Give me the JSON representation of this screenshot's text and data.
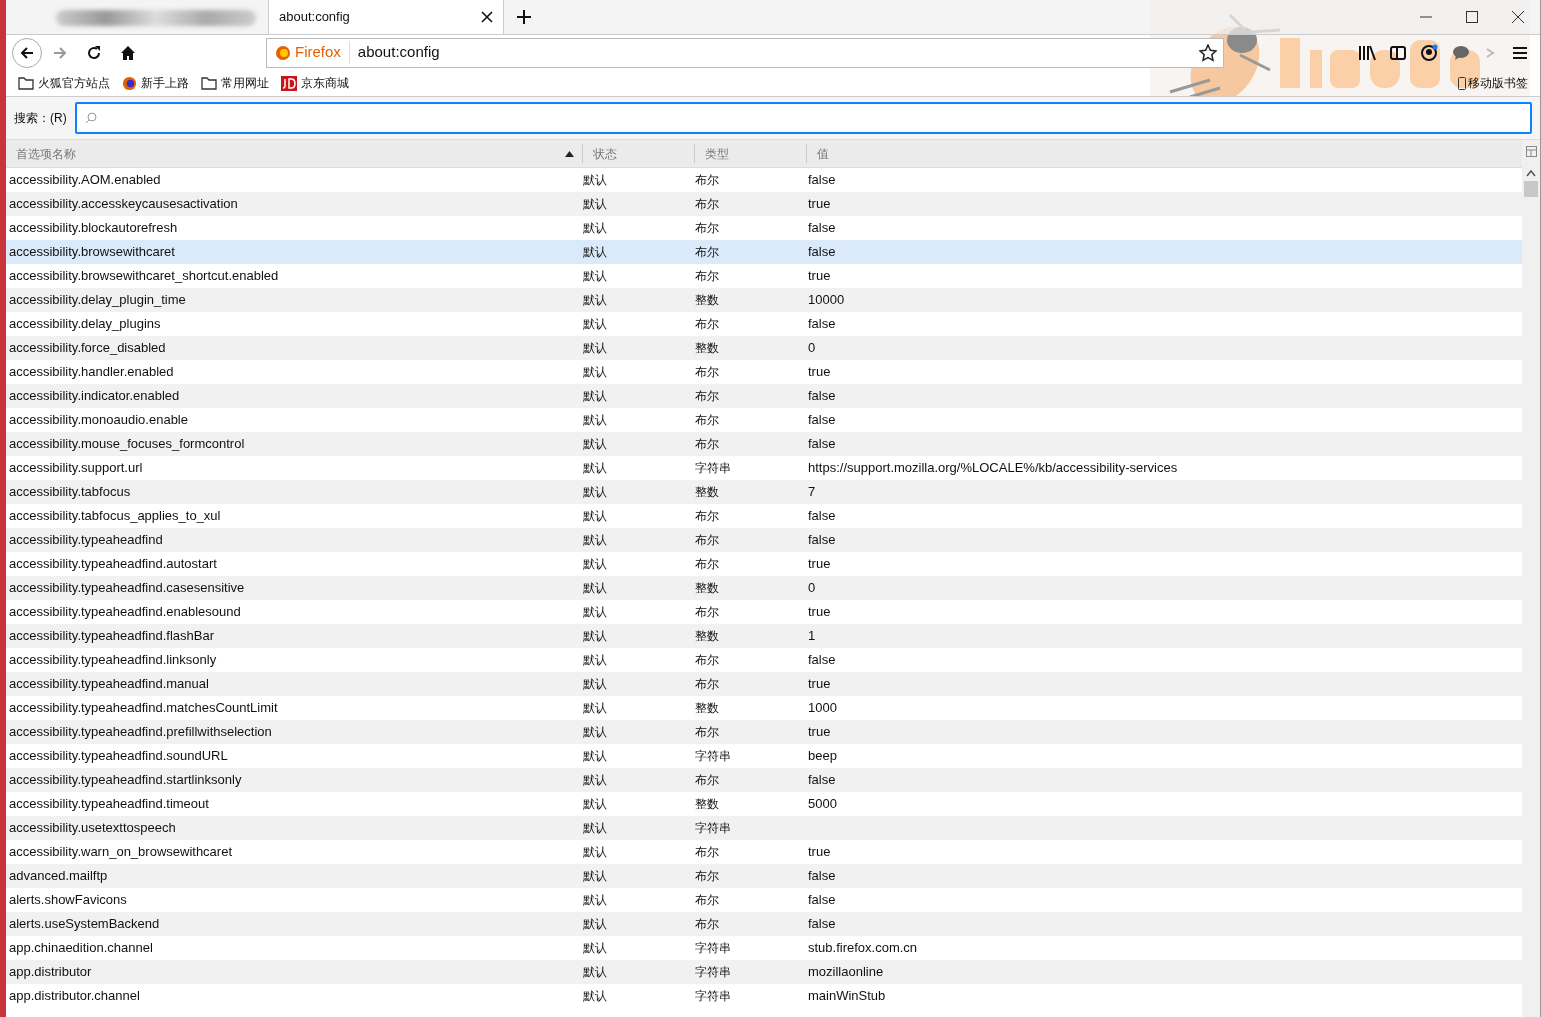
{
  "tabs": [
    {
      "kind": "blurred",
      "selected": false
    },
    {
      "kind": "page",
      "title": "about:config",
      "selected": true
    }
  ],
  "urlbar": {
    "identity": "Firefox",
    "url": "about:config"
  },
  "bookmarks": [
    {
      "kind": "folder",
      "label": "火狐官方站点"
    },
    {
      "kind": "firefox",
      "label": "新手上路"
    },
    {
      "kind": "folder",
      "label": "常用网址"
    },
    {
      "kind": "jd",
      "label": "京东商城"
    }
  ],
  "mobile_bookmarks": "移动版书签",
  "search": {
    "label": "搜索：(R)"
  },
  "columns": [
    {
      "label": "首选项名称",
      "sorted": true
    },
    {
      "label": "状态",
      "sorted": false
    },
    {
      "label": "类型",
      "sorted": false
    },
    {
      "label": "值",
      "sorted": false
    }
  ],
  "rows": [
    {
      "name": "accessibility.AOM.enabled",
      "status": "默认",
      "type": "布尔",
      "value": "false",
      "selected": false
    },
    {
      "name": "accessibility.accesskeycausesactivation",
      "status": "默认",
      "type": "布尔",
      "value": "true",
      "selected": false
    },
    {
      "name": "accessibility.blockautorefresh",
      "status": "默认",
      "type": "布尔",
      "value": "false",
      "selected": false
    },
    {
      "name": "accessibility.browsewithcaret",
      "status": "默认",
      "type": "布尔",
      "value": "false",
      "selected": true
    },
    {
      "name": "accessibility.browsewithcaret_shortcut.enabled",
      "status": "默认",
      "type": "布尔",
      "value": "true",
      "selected": false
    },
    {
      "name": "accessibility.delay_plugin_time",
      "status": "默认",
      "type": "整数",
      "value": "10000",
      "selected": false
    },
    {
      "name": "accessibility.delay_plugins",
      "status": "默认",
      "type": "布尔",
      "value": "false",
      "selected": false
    },
    {
      "name": "accessibility.force_disabled",
      "status": "默认",
      "type": "整数",
      "value": "0",
      "selected": false
    },
    {
      "name": "accessibility.handler.enabled",
      "status": "默认",
      "type": "布尔",
      "value": "true",
      "selected": false
    },
    {
      "name": "accessibility.indicator.enabled",
      "status": "默认",
      "type": "布尔",
      "value": "false",
      "selected": false
    },
    {
      "name": "accessibility.monoaudio.enable",
      "status": "默认",
      "type": "布尔",
      "value": "false",
      "selected": false
    },
    {
      "name": "accessibility.mouse_focuses_formcontrol",
      "status": "默认",
      "type": "布尔",
      "value": "false",
      "selected": false
    },
    {
      "name": "accessibility.support.url",
      "status": "默认",
      "type": "字符串",
      "value": "https://support.mozilla.org/%LOCALE%/kb/accessibility-services",
      "selected": false
    },
    {
      "name": "accessibility.tabfocus",
      "status": "默认",
      "type": "整数",
      "value": "7",
      "selected": false
    },
    {
      "name": "accessibility.tabfocus_applies_to_xul",
      "status": "默认",
      "type": "布尔",
      "value": "false",
      "selected": false
    },
    {
      "name": "accessibility.typeaheadfind",
      "status": "默认",
      "type": "布尔",
      "value": "false",
      "selected": false
    },
    {
      "name": "accessibility.typeaheadfind.autostart",
      "status": "默认",
      "type": "布尔",
      "value": "true",
      "selected": false
    },
    {
      "name": "accessibility.typeaheadfind.casesensitive",
      "status": "默认",
      "type": "整数",
      "value": "0",
      "selected": false
    },
    {
      "name": "accessibility.typeaheadfind.enablesound",
      "status": "默认",
      "type": "布尔",
      "value": "true",
      "selected": false
    },
    {
      "name": "accessibility.typeaheadfind.flashBar",
      "status": "默认",
      "type": "整数",
      "value": "1",
      "selected": false
    },
    {
      "name": "accessibility.typeaheadfind.linksonly",
      "status": "默认",
      "type": "布尔",
      "value": "false",
      "selected": false
    },
    {
      "name": "accessibility.typeaheadfind.manual",
      "status": "默认",
      "type": "布尔",
      "value": "true",
      "selected": false
    },
    {
      "name": "accessibility.typeaheadfind.matchesCountLimit",
      "status": "默认",
      "type": "整数",
      "value": "1000",
      "selected": false
    },
    {
      "name": "accessibility.typeaheadfind.prefillwithselection",
      "status": "默认",
      "type": "布尔",
      "value": "true",
      "selected": false
    },
    {
      "name": "accessibility.typeaheadfind.soundURL",
      "status": "默认",
      "type": "字符串",
      "value": "beep",
      "selected": false
    },
    {
      "name": "accessibility.typeaheadfind.startlinksonly",
      "status": "默认",
      "type": "布尔",
      "value": "false",
      "selected": false
    },
    {
      "name": "accessibility.typeaheadfind.timeout",
      "status": "默认",
      "type": "整数",
      "value": "5000",
      "selected": false
    },
    {
      "name": "accessibility.usetexttospeech",
      "status": "默认",
      "type": "字符串",
      "selected": false
    },
    {
      "name": "accessibility.warn_on_browsewithcaret",
      "status": "默认",
      "type": "布尔",
      "value": "true",
      "selected": false
    },
    {
      "name": "advanced.mailftp",
      "status": "默认",
      "type": "布尔",
      "value": "false",
      "selected": false
    },
    {
      "name": "alerts.showFavicons",
      "status": "默认",
      "type": "布尔",
      "value": "false",
      "selected": false
    },
    {
      "name": "alerts.useSystemBackend",
      "status": "默认",
      "type": "布尔",
      "value": "false",
      "selected": false
    },
    {
      "name": "app.chinaedition.channel",
      "status": "默认",
      "type": "字符串",
      "value": "stub.firefox.com.cn",
      "selected": false
    },
    {
      "name": "app.distributor",
      "status": "默认",
      "type": "字符串",
      "value": "mozillaonline",
      "selected": false
    },
    {
      "name": "app.distributor.channel",
      "status": "默认",
      "type": "字符串",
      "value": "mainWinStub",
      "selected": false
    }
  ]
}
